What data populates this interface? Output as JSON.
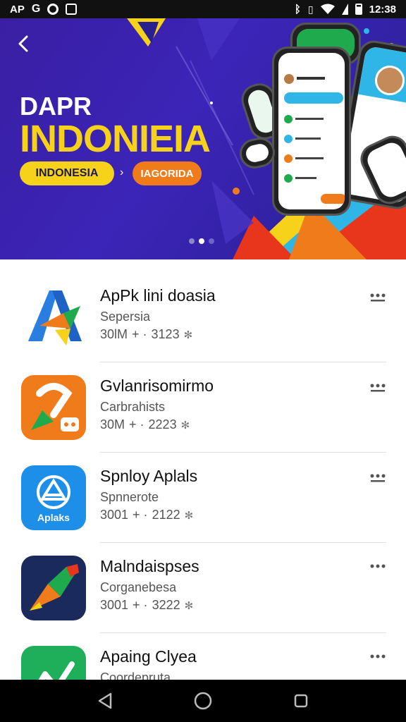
{
  "status_bar": {
    "left_text": "AP",
    "time": "12:38",
    "icons": [
      "g-icon",
      "circle-notification-icon",
      "square-notification-icon",
      "bluetooth-icon",
      "vibrate-icon",
      "wifi-icon",
      "signal-icon",
      "battery-icon"
    ]
  },
  "banner": {
    "back_icon": "chevron-left-icon",
    "title_line1": "DAPR",
    "title_line2": "INDONIEIA",
    "pill_yellow": "INDONESIA",
    "pill_arrow": "›",
    "pill_orange": "IAGORIDA",
    "carousel_dots": 3,
    "active_dot": 2
  },
  "apps": [
    {
      "name": "ApPk lini doasia",
      "category": "Sepersia",
      "size": "30lM",
      "date": "3123",
      "menu_icon": "more-icon"
    },
    {
      "name": "Gvlanrisomirmo",
      "category": "Carbrahists",
      "size": "30M",
      "date": "2223",
      "menu_icon": "more-icon"
    },
    {
      "name": "Spnloy Aplals",
      "category": "Spnnerote",
      "size": "3001",
      "date": "2122",
      "menu_icon": "more-icon"
    },
    {
      "name": "Malndaispses",
      "category": "Corganebesa",
      "size": "3001",
      "date": "3222",
      "menu_icon": "more-icon"
    },
    {
      "name": "Apaing Clyea",
      "category": "Coordepruta",
      "size": "",
      "date": "",
      "menu_icon": "more-icon"
    }
  ],
  "meta_sep": "+ ·",
  "app3_icon_text": "Aplaks",
  "colors": {
    "banner_bg": "#3b24b8",
    "accent_yellow": "#f6d21b",
    "accent_orange": "#f07b1b"
  }
}
